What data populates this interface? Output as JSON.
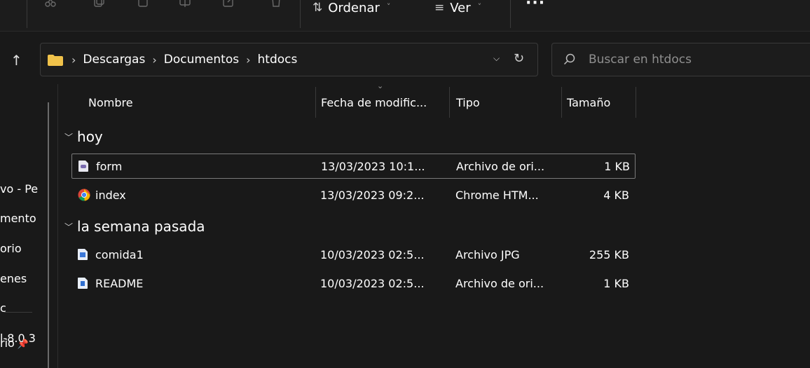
{
  "toolbar": {
    "sort_label": "Ordenar",
    "view_label": "Ver",
    "more_label": "···"
  },
  "address": {
    "crumbs": [
      "Descargas",
      "Documentos",
      "htdocs"
    ],
    "folder_color": "#f0c24a"
  },
  "search": {
    "placeholder": "Buscar en htdocs"
  },
  "nav": {
    "items": [
      "vo - Pe",
      "mento",
      "orio",
      "enes",
      "c",
      "l-8.0.3",
      "rio"
    ]
  },
  "columns": {
    "name": "Nombre",
    "date": "Fecha de modific...",
    "type": "Tipo",
    "size": "Tamaño"
  },
  "groups": [
    {
      "label": "hoy",
      "files": [
        {
          "name": "form",
          "date": "13/03/2023 10:1...",
          "type": "Archivo de ori...",
          "size": "1 KB",
          "icon": "php-file-icon",
          "selected": true
        },
        {
          "name": "index",
          "date": "13/03/2023 09:2...",
          "type": "Chrome HTM...",
          "size": "4 KB",
          "icon": "chrome-icon",
          "selected": false
        }
      ]
    },
    {
      "label": "la semana pasada",
      "files": [
        {
          "name": "comida1",
          "date": "10/03/2023 02:5...",
          "type": "Archivo JPG",
          "size": "255 KB",
          "icon": "image-file-icon",
          "selected": false
        },
        {
          "name": "README",
          "date": "10/03/2023 02:5...",
          "type": "Archivo de ori...",
          "size": "1 KB",
          "icon": "text-file-icon",
          "selected": false
        }
      ]
    }
  ]
}
